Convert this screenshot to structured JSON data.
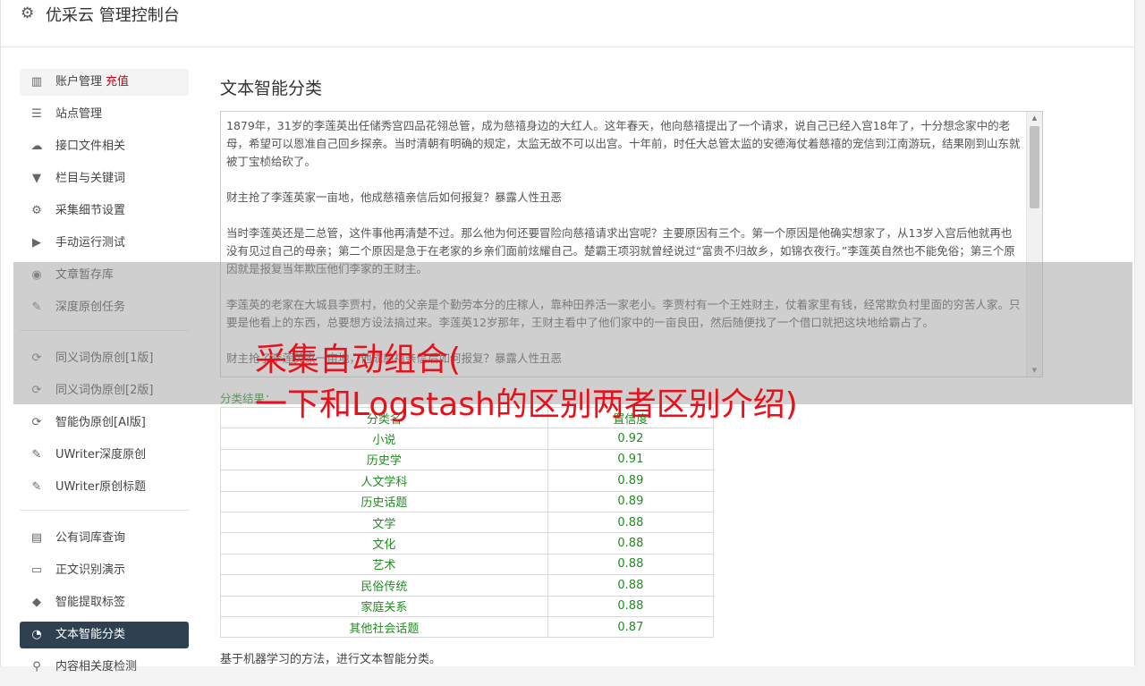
{
  "header": {
    "title": "优采云 管理控制台"
  },
  "sidebar": {
    "items": [
      {
        "label": "账户管理",
        "badge": "充值",
        "icon": "bar-chart-icon"
      },
      {
        "label": "站点管理",
        "icon": "server-icon"
      },
      {
        "label": "接口文件相关",
        "icon": "cloud-upload-icon"
      },
      {
        "label": "栏目与关键词",
        "icon": "filter-icon"
      },
      {
        "label": "采集细节设置",
        "icon": "cogs-icon"
      },
      {
        "label": "手动运行测试",
        "icon": "play-circle-icon"
      },
      {
        "label": "文章暂存库",
        "icon": "database-icon"
      },
      {
        "label": "深度原创任务",
        "icon": "edit-icon"
      },
      {
        "label": "同义词伪原创[1版]",
        "icon": "refresh-icon"
      },
      {
        "label": "同义词伪原创[2版]",
        "icon": "refresh-icon"
      },
      {
        "label": "智能伪原创[AI版]",
        "icon": "refresh-icon"
      },
      {
        "label": "UWriter深度原创",
        "icon": "edit-icon"
      },
      {
        "label": "UWriter原创标题",
        "icon": "edit-icon"
      },
      {
        "label": "公有词库查询",
        "icon": "book-icon"
      },
      {
        "label": "正文识别演示",
        "icon": "desktop-icon"
      },
      {
        "label": "智能提取标签",
        "icon": "tag-icon"
      },
      {
        "label": "文本智能分类",
        "icon": "pie-chart-icon"
      },
      {
        "label": "内容相关度检测",
        "icon": "search-icon"
      }
    ]
  },
  "main": {
    "title": "文本智能分类",
    "paragraphs": [
      "1879年，31岁的李莲英出任储秀宫四品花翎总管，成为慈禧身边的大红人。这年春天，他向慈禧提出了一个请求，说自己已经入宫18年了，十分想念家中的老母，希望可以恩准自己回乡探亲。当时清朝有明确的规定，太监无故不可以出宫。十年前，时任大总管太监的安德海仗着慈禧的宠信到江南游玩，结果刚到山东就被丁宝桢给砍了。",
      "财主抢了李莲英家一亩地，他成慈禧亲信后如何报复？暴露人性丑恶",
      "当时李莲英还是二总管，这件事他再清楚不过。那么他为何还要冒险向慈禧请求出宫呢？主要原因有三个。第一个原因是他确实想家了，从13岁入宫后他就再也没有见过自己的母亲；第二个原因是急于在老家的乡亲们面前炫耀自己。楚霸王项羽就曾经说过“富贵不归故乡，如锦衣夜行。”李莲英自然也不能免俗；第三个原因就是报复当年欺压他们李家的王财主。",
      "李莲英的老家在大城县李贾村，他的父亲是个勤劳本分的庄稼人，靠种田养活一家老小。李贾村有一个王姓财主，仗着家里有钱，经常欺负村里面的穷苦人家。只要是他看上的东西，总要想方设法搞过来。李莲英12岁那年，王财主看中了他们家中的一亩良田，然后随便找了一个借口就把这块地给霸占了。",
      "财主抢了李莲英家一亩地，他成慈禧亲信后如何报复？暴露人性丑恶"
    ],
    "result_label": "分类结果：",
    "table": {
      "headers": [
        "分类名",
        "置信度"
      ],
      "rows": [
        [
          "小说",
          "0.92"
        ],
        [
          "历史学",
          "0.91"
        ],
        [
          "人文学科",
          "0.89"
        ],
        [
          "历史话题",
          "0.89"
        ],
        [
          "文学",
          "0.88"
        ],
        [
          "文化",
          "0.88"
        ],
        [
          "艺术",
          "0.88"
        ],
        [
          "民俗传统",
          "0.88"
        ],
        [
          "家庭关系",
          "0.88"
        ],
        [
          "其他社会话题",
          "0.87"
        ]
      ]
    },
    "footnote": "基于机器学习的方法，进行文本智能分类。"
  },
  "watermark": {
    "line1": "采集自动组合(",
    "line2": "一下和Logstash的区别两者区别介绍)"
  },
  "colors": {
    "active_bg": "#2f4050",
    "badge": "#d0021b",
    "result": "#228b22",
    "watermark": "#e8101a"
  }
}
